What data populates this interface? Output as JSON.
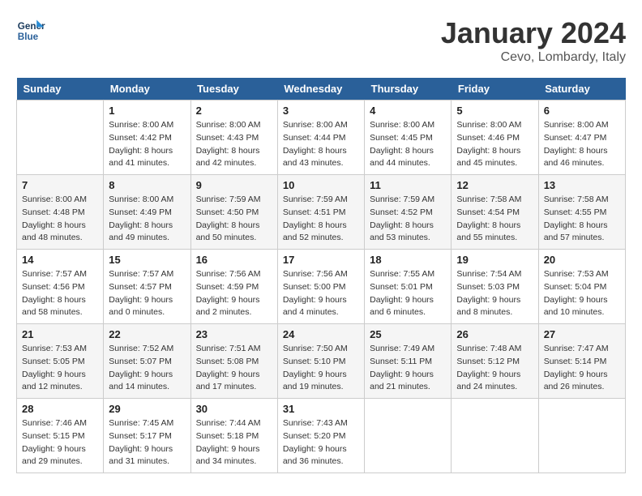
{
  "header": {
    "logo_line1": "General",
    "logo_line2": "Blue",
    "month": "January 2024",
    "location": "Cevo, Lombardy, Italy"
  },
  "weekdays": [
    "Sunday",
    "Monday",
    "Tuesday",
    "Wednesday",
    "Thursday",
    "Friday",
    "Saturday"
  ],
  "weeks": [
    [
      {
        "day": "",
        "info": ""
      },
      {
        "day": "1",
        "info": "Sunrise: 8:00 AM\nSunset: 4:42 PM\nDaylight: 8 hours\nand 41 minutes."
      },
      {
        "day": "2",
        "info": "Sunrise: 8:00 AM\nSunset: 4:43 PM\nDaylight: 8 hours\nand 42 minutes."
      },
      {
        "day": "3",
        "info": "Sunrise: 8:00 AM\nSunset: 4:44 PM\nDaylight: 8 hours\nand 43 minutes."
      },
      {
        "day": "4",
        "info": "Sunrise: 8:00 AM\nSunset: 4:45 PM\nDaylight: 8 hours\nand 44 minutes."
      },
      {
        "day": "5",
        "info": "Sunrise: 8:00 AM\nSunset: 4:46 PM\nDaylight: 8 hours\nand 45 minutes."
      },
      {
        "day": "6",
        "info": "Sunrise: 8:00 AM\nSunset: 4:47 PM\nDaylight: 8 hours\nand 46 minutes."
      }
    ],
    [
      {
        "day": "7",
        "info": "Sunrise: 8:00 AM\nSunset: 4:48 PM\nDaylight: 8 hours\nand 48 minutes."
      },
      {
        "day": "8",
        "info": "Sunrise: 8:00 AM\nSunset: 4:49 PM\nDaylight: 8 hours\nand 49 minutes."
      },
      {
        "day": "9",
        "info": "Sunrise: 7:59 AM\nSunset: 4:50 PM\nDaylight: 8 hours\nand 50 minutes."
      },
      {
        "day": "10",
        "info": "Sunrise: 7:59 AM\nSunset: 4:51 PM\nDaylight: 8 hours\nand 52 minutes."
      },
      {
        "day": "11",
        "info": "Sunrise: 7:59 AM\nSunset: 4:52 PM\nDaylight: 8 hours\nand 53 minutes."
      },
      {
        "day": "12",
        "info": "Sunrise: 7:58 AM\nSunset: 4:54 PM\nDaylight: 8 hours\nand 55 minutes."
      },
      {
        "day": "13",
        "info": "Sunrise: 7:58 AM\nSunset: 4:55 PM\nDaylight: 8 hours\nand 57 minutes."
      }
    ],
    [
      {
        "day": "14",
        "info": "Sunrise: 7:57 AM\nSunset: 4:56 PM\nDaylight: 8 hours\nand 58 minutes."
      },
      {
        "day": "15",
        "info": "Sunrise: 7:57 AM\nSunset: 4:57 PM\nDaylight: 9 hours\nand 0 minutes."
      },
      {
        "day": "16",
        "info": "Sunrise: 7:56 AM\nSunset: 4:59 PM\nDaylight: 9 hours\nand 2 minutes."
      },
      {
        "day": "17",
        "info": "Sunrise: 7:56 AM\nSunset: 5:00 PM\nDaylight: 9 hours\nand 4 minutes."
      },
      {
        "day": "18",
        "info": "Sunrise: 7:55 AM\nSunset: 5:01 PM\nDaylight: 9 hours\nand 6 minutes."
      },
      {
        "day": "19",
        "info": "Sunrise: 7:54 AM\nSunset: 5:03 PM\nDaylight: 9 hours\nand 8 minutes."
      },
      {
        "day": "20",
        "info": "Sunrise: 7:53 AM\nSunset: 5:04 PM\nDaylight: 9 hours\nand 10 minutes."
      }
    ],
    [
      {
        "day": "21",
        "info": "Sunrise: 7:53 AM\nSunset: 5:05 PM\nDaylight: 9 hours\nand 12 minutes."
      },
      {
        "day": "22",
        "info": "Sunrise: 7:52 AM\nSunset: 5:07 PM\nDaylight: 9 hours\nand 14 minutes."
      },
      {
        "day": "23",
        "info": "Sunrise: 7:51 AM\nSunset: 5:08 PM\nDaylight: 9 hours\nand 17 minutes."
      },
      {
        "day": "24",
        "info": "Sunrise: 7:50 AM\nSunset: 5:10 PM\nDaylight: 9 hours\nand 19 minutes."
      },
      {
        "day": "25",
        "info": "Sunrise: 7:49 AM\nSunset: 5:11 PM\nDaylight: 9 hours\nand 21 minutes."
      },
      {
        "day": "26",
        "info": "Sunrise: 7:48 AM\nSunset: 5:12 PM\nDaylight: 9 hours\nand 24 minutes."
      },
      {
        "day": "27",
        "info": "Sunrise: 7:47 AM\nSunset: 5:14 PM\nDaylight: 9 hours\nand 26 minutes."
      }
    ],
    [
      {
        "day": "28",
        "info": "Sunrise: 7:46 AM\nSunset: 5:15 PM\nDaylight: 9 hours\nand 29 minutes."
      },
      {
        "day": "29",
        "info": "Sunrise: 7:45 AM\nSunset: 5:17 PM\nDaylight: 9 hours\nand 31 minutes."
      },
      {
        "day": "30",
        "info": "Sunrise: 7:44 AM\nSunset: 5:18 PM\nDaylight: 9 hours\nand 34 minutes."
      },
      {
        "day": "31",
        "info": "Sunrise: 7:43 AM\nSunset: 5:20 PM\nDaylight: 9 hours\nand 36 minutes."
      },
      {
        "day": "",
        "info": ""
      },
      {
        "day": "",
        "info": ""
      },
      {
        "day": "",
        "info": ""
      }
    ]
  ]
}
